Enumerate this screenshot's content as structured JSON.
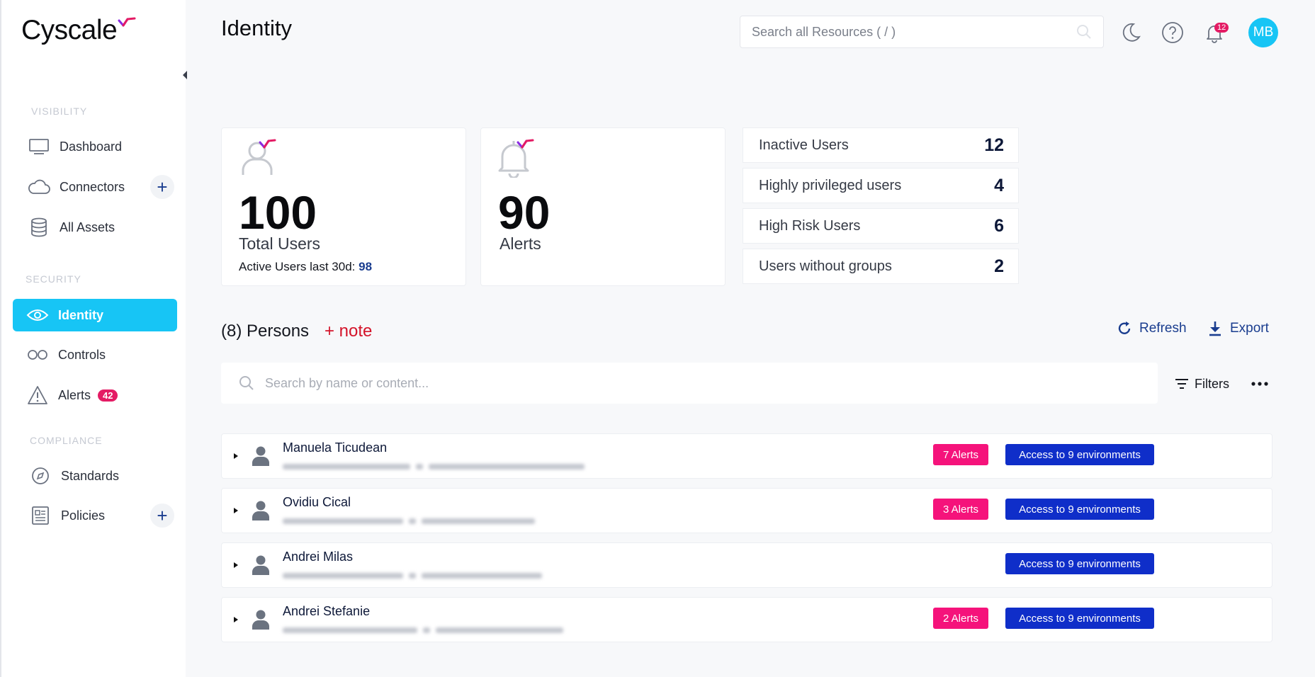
{
  "app": {
    "logo_text": "Cyscale",
    "brand_color": "#17c5f5",
    "accent_magenta": "#e41b64"
  },
  "sidebar": {
    "sections": [
      {
        "label": "VISIBILITY"
      },
      {
        "label": "SECURITY"
      },
      {
        "label": "COMPLIANCE"
      }
    ],
    "items": [
      {
        "label": "Dashboard",
        "icon": "monitor-icon"
      },
      {
        "label": "Connectors",
        "icon": "cloud-icon",
        "has_add": true
      },
      {
        "label": "All Assets",
        "icon": "database-icon"
      },
      {
        "label": "Identity",
        "icon": "eye-icon",
        "active": true
      },
      {
        "label": "Controls",
        "icon": "infinity-icon"
      },
      {
        "label": "Alerts",
        "icon": "warning-icon",
        "badge": "42"
      },
      {
        "label": "Standards",
        "icon": "compass-icon"
      },
      {
        "label": "Policies",
        "icon": "document-icon",
        "has_add": true
      }
    ]
  },
  "header": {
    "title": "Identity",
    "search_placeholder": "Search all Resources ( / )",
    "notifications_count": "12",
    "avatar_initials": "MB"
  },
  "cards": {
    "total_users": {
      "value": "100",
      "label": "Total Users",
      "active_label": "Active Users last 30d:",
      "active_value": "98"
    },
    "alerts": {
      "value": "90",
      "label": "Alerts"
    }
  },
  "stats": [
    {
      "label": "Inactive Users",
      "value": "12"
    },
    {
      "label": "Highly privileged users",
      "value": "4"
    },
    {
      "label": "High Risk Users",
      "value": "6"
    },
    {
      "label": "Users without groups",
      "value": "2"
    }
  ],
  "persons": {
    "title": "(8) Persons",
    "note_label": "+ note",
    "refresh_label": "Refresh",
    "export_label": "Export",
    "search_placeholder": "Search by name or content...",
    "filters_label": "Filters",
    "rows": [
      {
        "name": "Manuela Ticudean",
        "alerts": "7 Alerts",
        "environments": "Access to 9 environments"
      },
      {
        "name": "Ovidiu Cical",
        "alerts": "3 Alerts",
        "environments": "Access to 9 environments"
      },
      {
        "name": "Andrei Milas",
        "alerts": "",
        "environments": "Access to 9 environments"
      },
      {
        "name": "Andrei Stefanie",
        "alerts": "2 Alerts",
        "environments": "Access to 9 environments"
      }
    ]
  }
}
